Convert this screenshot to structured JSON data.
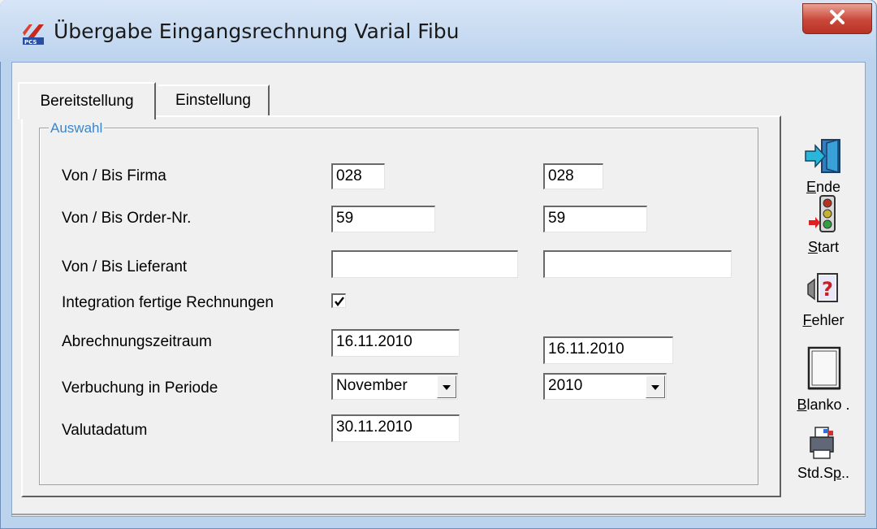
{
  "window": {
    "title": "Übergabe Eingangsrechnung Varial Fibu",
    "close_glyph": "✕"
  },
  "tabs": [
    {
      "label": "Bereitstellung",
      "active": true
    },
    {
      "label": "Einstellung",
      "active": false
    }
  ],
  "group": {
    "legend": "Auswahl",
    "legend_color": "#3a86c8"
  },
  "rows": {
    "firma": {
      "label": "Von / Bis  Firma",
      "from": "028",
      "to": "028"
    },
    "order": {
      "label": "Von / Bis  Order-Nr.",
      "from": "59",
      "to": "59"
    },
    "lieferant": {
      "label": "Von / Bis Lieferant",
      "from": "",
      "to": ""
    },
    "integration": {
      "label": "Integration fertige Rechnungen",
      "checked": true
    },
    "abrechnung": {
      "label": "Abrechnungszeitraum",
      "from": "16.11.2010",
      "to": "16.11.2010"
    },
    "verbuchung": {
      "label": "Verbuchung in Periode",
      "month": "November",
      "year": "2010"
    },
    "valuta": {
      "label": "Valutadatum",
      "value": "30.11.2010"
    }
  },
  "side_buttons": {
    "ende": {
      "label_u": "E",
      "label_rest": "nde",
      "icon": "exit-door-icon"
    },
    "start": {
      "label_u": "S",
      "label_rest": "tart",
      "icon": "traffic-light-icon"
    },
    "fehler": {
      "label_u": "F",
      "label_rest": "ehler",
      "icon": "error-report-icon"
    },
    "blanko": {
      "label_u": "B",
      "label_rest": "lanko .",
      "icon": "blank-document-icon"
    },
    "stdsp": {
      "label_pre": "Std.S",
      "label_u": "p",
      "label_rest": "..",
      "icon": "printer-icon"
    }
  }
}
